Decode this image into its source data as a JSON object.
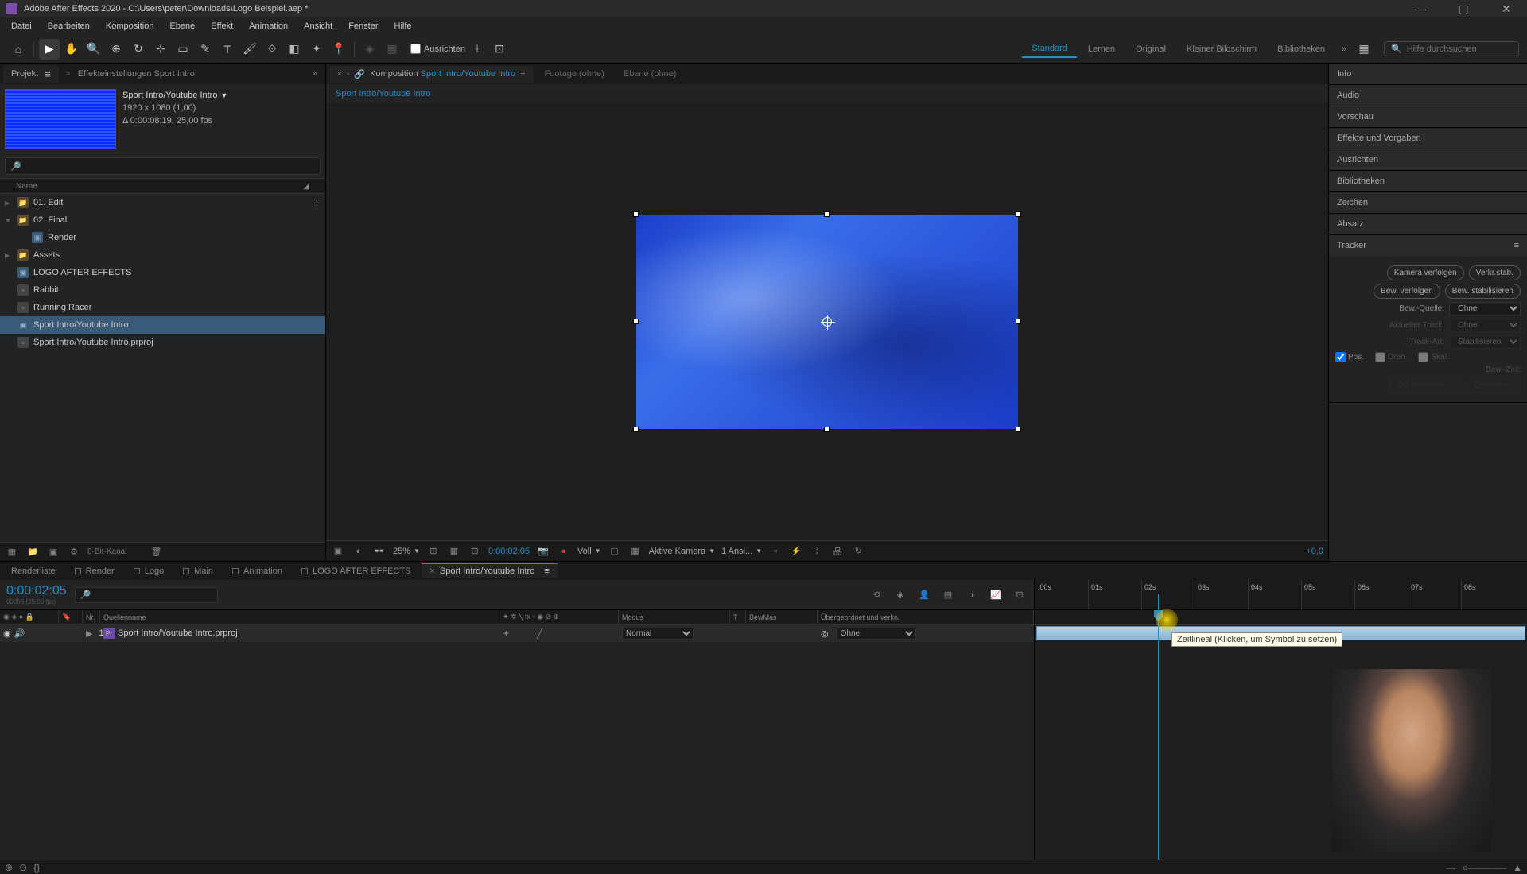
{
  "window": {
    "title": "Adobe After Effects 2020 - C:\\Users\\peter\\Downloads\\Logo Beispiel.aep *"
  },
  "menu": [
    "Datei",
    "Bearbeiten",
    "Komposition",
    "Ebene",
    "Effekt",
    "Animation",
    "Ansicht",
    "Fenster",
    "Hilfe"
  ],
  "toolbar": {
    "align": "Ausrichten",
    "workspaces": [
      "Standard",
      "Lernen",
      "Original",
      "Kleiner Bildschirm",
      "Bibliotheken"
    ],
    "active_ws": 0,
    "search_placeholder": "Hilfe durchsuchen"
  },
  "project": {
    "tab": "Projekt",
    "secondary_tab": "Effekteinstellungen Sport Intro",
    "comp_name": "Sport Intro/Youtube Intro",
    "dims": "1920 x 1080 (1,00)",
    "duration": "Δ 0:00:08:19, 25,00 fps",
    "name_col": "Name",
    "items": [
      {
        "label": "01. Edit",
        "type": "folder",
        "indent": 0,
        "exp": "▶"
      },
      {
        "label": "02. Final",
        "type": "folder",
        "indent": 0,
        "exp": "▼"
      },
      {
        "label": "Render",
        "type": "comp",
        "indent": 1,
        "exp": ""
      },
      {
        "label": "Assets",
        "type": "folder",
        "indent": 0,
        "exp": "▶"
      },
      {
        "label": "LOGO AFTER EFFECTS",
        "type": "comp",
        "indent": 0,
        "exp": ""
      },
      {
        "label": "Rabbit",
        "type": "footage",
        "indent": 0,
        "exp": ""
      },
      {
        "label": "Running Racer",
        "type": "footage",
        "indent": 0,
        "exp": ""
      },
      {
        "label": "Sport Intro/Youtube Intro",
        "type": "comp",
        "indent": 0,
        "exp": "",
        "selected": true
      },
      {
        "label": "Sport Intro/Youtube Intro.prproj",
        "type": "footage",
        "indent": 0,
        "exp": ""
      }
    ],
    "depth": "8-Bit-Kanal"
  },
  "comp": {
    "tab_prefix": "Komposition",
    "tab_name": "Sport Intro/Youtube Intro",
    "footage_tab": "Footage (ohne)",
    "layer_tab": "Ebene (ohne)",
    "breadcrumb": "Sport Intro/Youtube Intro",
    "footer": {
      "zoom": "25%",
      "timecode": "0:00:02:05",
      "res": "Voll",
      "camera": "Aktive Kamera",
      "views": "1 Ansi...",
      "offset": "+0,0"
    }
  },
  "right_panels": [
    "Info",
    "Audio",
    "Vorschau",
    "Effekte und Vorgaben",
    "Ausrichten",
    "Bibliotheken",
    "Zeichen",
    "Absatz",
    "Tracker"
  ],
  "tracker": {
    "btn_track_camera": "Kamera verfolgen",
    "btn_warp": "Verkr.stab.",
    "btn_track_motion": "Bew. verfolgen",
    "btn_stabilize": "Bew. stabilisieren",
    "source_lbl": "Bew.-Quelle:",
    "source_val": "Ohne",
    "current_lbl": "Aktueller Track:",
    "current_val": "Ohne",
    "type_lbl": "Track-Art:",
    "type_val": "Stabilisieren",
    "pos": "Pos.",
    "rot": "Dreh.",
    "scale": "Skal.",
    "target_lbl": "Bew.-Ziel:",
    "edit_btn": "Ziel bearbeiten...",
    "options_btn": "Optionen..."
  },
  "timeline_tabs": [
    {
      "label": "Renderliste",
      "dot": false
    },
    {
      "label": "Render",
      "dot": true
    },
    {
      "label": "Logo",
      "dot": true
    },
    {
      "label": "Main",
      "dot": true
    },
    {
      "label": "Animation",
      "dot": true
    },
    {
      "label": "LOGO AFTER EFFECTS",
      "dot": true
    },
    {
      "label": "Sport Intro/Youtube Intro",
      "dot": false,
      "active": true,
      "close": true
    }
  ],
  "timeline": {
    "time": "0:00:02:05",
    "subtime": "00055 (25.00 fps)",
    "cols": {
      "nr": "Nr.",
      "source": "Quellenname",
      "mode": "Modus",
      "t": "T",
      "trkmat": "BewMas",
      "parent": "Übergeordnet und verkn."
    },
    "layer": {
      "num": "1",
      "name": "Sport Intro/Youtube Intro.prproj",
      "mode": "Normal",
      "parent": "Ohne"
    },
    "ticks": [
      ":00s",
      "01s",
      "02s",
      "03s",
      "04s",
      "05s",
      "06s",
      "07s",
      "08s"
    ],
    "tooltip": "Zeitlineal (Klicken, um Symbol zu setzen)"
  }
}
